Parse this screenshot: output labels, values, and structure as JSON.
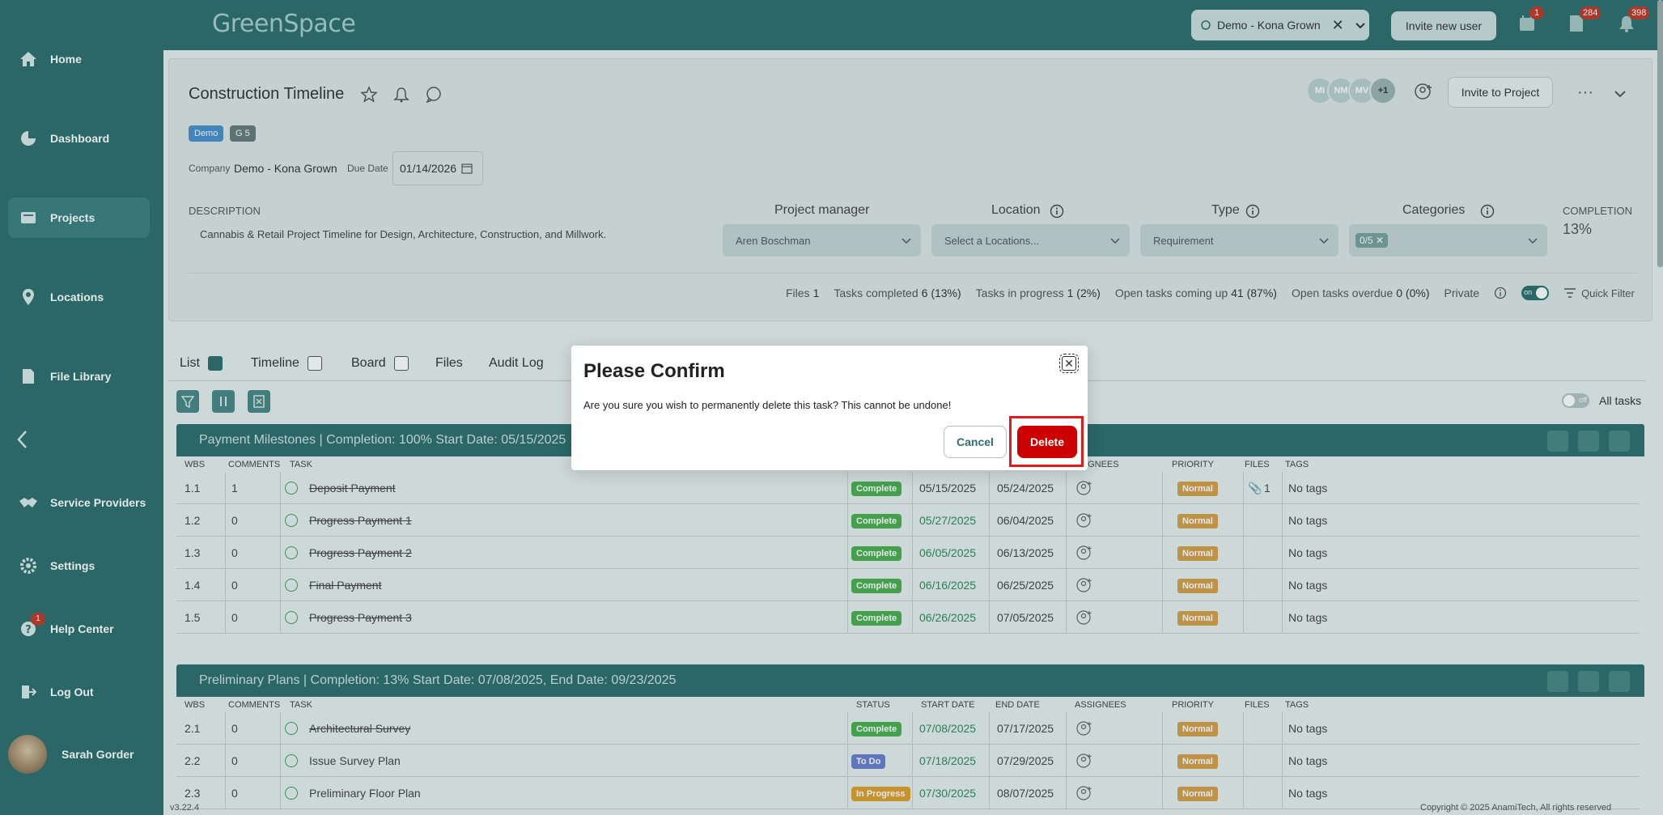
{
  "app": {
    "logo": "GreenSpace",
    "version": "v3.22.4",
    "copyright": "Copyright © 2025 AnamiTech, All rights reserved"
  },
  "sidebar": {
    "items": [
      {
        "label": "Home",
        "icon": "home-icon"
      },
      {
        "label": "Dashboard",
        "icon": "pie-chart-icon"
      },
      {
        "label": "Projects",
        "icon": "projects-icon",
        "active": true
      },
      {
        "label": "Locations",
        "icon": "map-pin-icon"
      },
      {
        "label": "File Library",
        "icon": "file-icon"
      },
      {
        "label": "Service Providers",
        "icon": "handshake-icon"
      },
      {
        "label": "Settings",
        "icon": "gear-icon"
      },
      {
        "label": "Help Center",
        "icon": "help-icon",
        "badge": "1"
      },
      {
        "label": "Log Out",
        "icon": "logout-icon"
      }
    ],
    "user_name": "Sarah Gorder"
  },
  "topbar": {
    "workspace": "Demo - Kona Grown",
    "invite_user": "Invite new user",
    "badges": {
      "calendar": "1",
      "docs": "284",
      "notifications": "398"
    }
  },
  "project": {
    "title": "Construction Timeline",
    "tags": [
      "Demo",
      "G 5"
    ],
    "company_label": "Company",
    "company": "Demo - Kona Grown",
    "due_label": "Due Date",
    "due_date": "01/14/2026",
    "avatars": [
      "MI",
      "NM",
      "MV",
      "+1"
    ],
    "invite_project": "Invite to Project",
    "description_label": "DESCRIPTION",
    "description": "Cannabis & Retail Project Timeline for Design, Architecture, Construction, and Millwork.",
    "fields": {
      "project_manager_label": "Project manager",
      "project_manager": "Aren Boschman",
      "location_label": "Location",
      "location": "Select a Locations...",
      "type_label": "Type",
      "type": "Requirement",
      "categories_label": "Categories",
      "categories": "0/5"
    },
    "completion_label": "COMPLETION",
    "completion": "13%",
    "stats": {
      "files_label": "Files",
      "files": "1",
      "completed_label": "Tasks completed",
      "completed": "6 (13%)",
      "progress_label": "Tasks in progress",
      "progress": "1 (2%)",
      "upcoming_label": "Open tasks coming up",
      "upcoming": "41 (87%)",
      "overdue_label": "Open tasks overdue",
      "overdue": "0 (0%)",
      "private_label": "Private",
      "toggle_on": "on",
      "quick_filter": "Quick Filter"
    }
  },
  "tabs": [
    "List",
    "Timeline",
    "Board",
    "Files",
    "Audit Log"
  ],
  "all_tasks": {
    "toggle": "off",
    "label": "All tasks"
  },
  "columns": [
    "WBS",
    "COMMENTS",
    "TASK",
    "STATUS",
    "START DATE",
    "END DATE",
    "ASSIGNEES",
    "PRIORITY",
    "FILES",
    "TAGS"
  ],
  "groups": [
    {
      "title": "Payment Milestones  | Completion: 100%  Start Date: 05/15/2025",
      "rows": [
        {
          "wbs": "1.1",
          "comments": "1",
          "task": "Deposit Payment",
          "status": "Complete",
          "start": "05/15/2025",
          "end": "05/24/2025",
          "priority": "Normal",
          "files": "1",
          "tags": "No tags"
        },
        {
          "wbs": "1.2",
          "comments": "0",
          "task": "Progress Payment 1",
          "status": "Complete",
          "start": "05/27/2025",
          "end": "06/04/2025",
          "priority": "Normal",
          "files": "",
          "tags": "No tags"
        },
        {
          "wbs": "1.3",
          "comments": "0",
          "task": "Progress Payment 2",
          "status": "Complete",
          "start": "06/05/2025",
          "end": "06/13/2025",
          "priority": "Normal",
          "files": "",
          "tags": "No tags"
        },
        {
          "wbs": "1.4",
          "comments": "0",
          "task": "Final Payment",
          "status": "Complete",
          "start": "06/16/2025",
          "end": "06/25/2025",
          "priority": "Normal",
          "files": "",
          "tags": "No tags"
        },
        {
          "wbs": "1.5",
          "comments": "0",
          "task": "Progress Payment 3",
          "status": "Complete",
          "start": "06/26/2025",
          "end": "07/05/2025",
          "priority": "Normal",
          "files": "",
          "tags": "No tags"
        }
      ]
    },
    {
      "title": "Preliminary Plans  | Completion: 13%  Start Date: 07/08/2025, End Date: 09/23/2025",
      "rows": [
        {
          "wbs": "2.1",
          "comments": "0",
          "task": "Architectural Survey",
          "status": "Complete",
          "start": "07/08/2025",
          "end": "07/17/2025",
          "priority": "Normal",
          "files": "",
          "tags": "No tags"
        },
        {
          "wbs": "2.2",
          "comments": "0",
          "task": "Issue Survey Plan",
          "status": "To Do",
          "start": "07/18/2025",
          "end": "07/29/2025",
          "priority": "Normal",
          "files": "",
          "tags": "No tags"
        },
        {
          "wbs": "2.3",
          "comments": "0",
          "task": "Preliminary Floor Plan",
          "status": "In Progress",
          "start": "07/30/2025",
          "end": "08/07/2025",
          "priority": "Normal",
          "files": "",
          "tags": "No tags"
        }
      ]
    }
  ],
  "dialog": {
    "title": "Please Confirm",
    "message": "Are you sure you wish to permanently delete this task? This cannot be undone!",
    "cancel": "Cancel",
    "delete": "Delete"
  },
  "colors": {
    "brand": "#2f6e6e",
    "danger": "#cc0000",
    "complete": "#4caf50",
    "todo": "#6a7fd1",
    "in_progress": "#e0a030",
    "priority": "#d7a04a"
  }
}
